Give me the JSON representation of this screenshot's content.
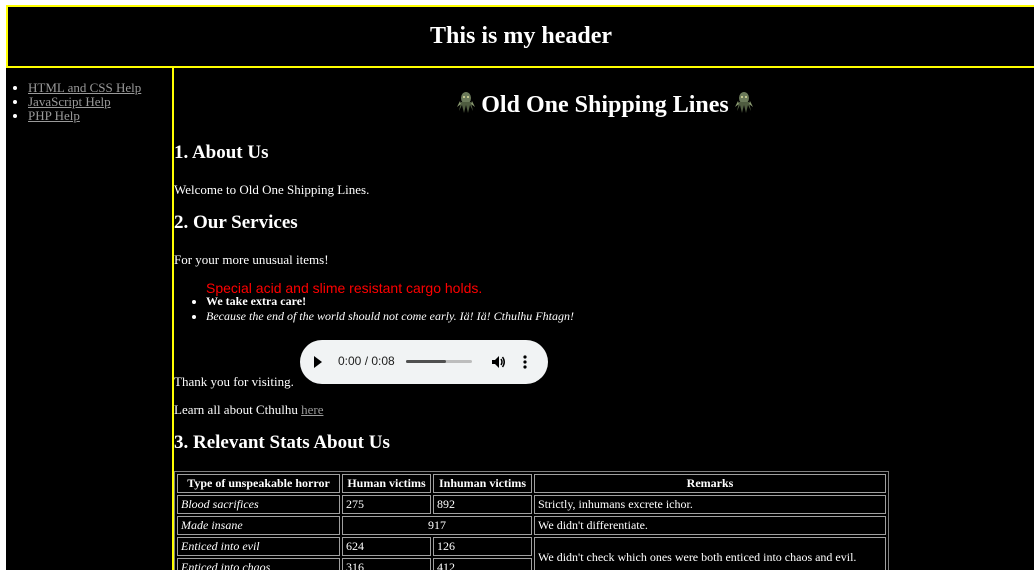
{
  "header": {
    "title": "This is my header"
  },
  "sidebar": {
    "items": [
      {
        "label": "HTML and CSS Help"
      },
      {
        "label": "JavaScript Help"
      },
      {
        "label": "PHP Help"
      }
    ]
  },
  "main": {
    "title": "Old One Shipping Lines",
    "title_icon": "cthulhu-icon",
    "sections": [
      {
        "title": "1. About Us",
        "text": "Welcome to Old One Shipping Lines."
      },
      {
        "title": "2. Our Services",
        "text": "For your more unusual items!"
      },
      {
        "title": "3. Relevant Stats About Us"
      }
    ],
    "special_line": "Special acid and slime resistant cargo holds.",
    "service_items": [
      "We take extra care!",
      "Because the end of the world should not come early. Iä! Iä! Cthulhu Fhtagn!"
    ],
    "thank_you": "Thank you for visiting.",
    "learn_more_prefix": "Learn all about Cthulhu ",
    "learn_more_link": "here",
    "colors": {
      "border": "#ffff00",
      "special_line": "#ff0000",
      "link": "#9a9a9a"
    }
  },
  "audio": {
    "time": "0:00 / 0:08",
    "progress": 0.6,
    "play_icon": "play-icon",
    "volume_icon": "volume-icon",
    "more_icon": "more-options-icon"
  },
  "stats_table": {
    "headers": [
      "Type of unspeakable horror",
      "Human victims",
      "Inhuman victims",
      "Remarks"
    ],
    "rows": [
      {
        "type": "Blood sacrifices",
        "human": "275",
        "inhuman": "892",
        "remarks": "Strictly, inhumans excrete ichor."
      },
      {
        "type": "Made insane",
        "combined": "917",
        "remarks": "We didn't differentiate."
      },
      {
        "type": "Enticed into evil",
        "human": "624",
        "inhuman": "126",
        "remarks": "We didn't check which ones were both enticed into chaos and evil."
      },
      {
        "type": "Enticed into chaos",
        "human": "316",
        "inhuman": "412"
      }
    ]
  }
}
